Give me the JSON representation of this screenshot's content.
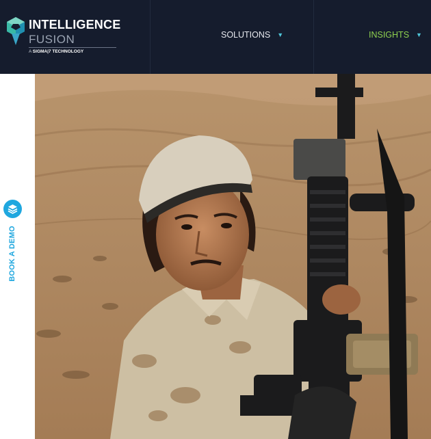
{
  "header": {
    "logo": {
      "line1": "INTELLIGENCE",
      "line2": "FUSION",
      "tagline_prefix": "A",
      "tagline_brand": "SIGMA",
      "tagline_suffix": "|7 TECHNOLOGY",
      "icon": "hexagon-map-pin-icon"
    },
    "nav": [
      {
        "label": "SOLUTIONS",
        "icon": "triangle-down-icon"
      },
      {
        "label": "INSIGHTS",
        "icon": "triangle-down-icon"
      }
    ]
  },
  "sidebar": {
    "book_demo_label": "BOOK A DEMO",
    "icon": "stacked-layers-icon"
  },
  "hero": {
    "image": "photo of a young man in desert camouflage uniform and beige cap holding a black assault rifle in a rocky desert landscape"
  },
  "colors": {
    "header_bg": "#151c2d",
    "accent_cyan": "#1fa7df",
    "accent_green": "#8fd14f",
    "nav_text": "#e6e8ee"
  }
}
